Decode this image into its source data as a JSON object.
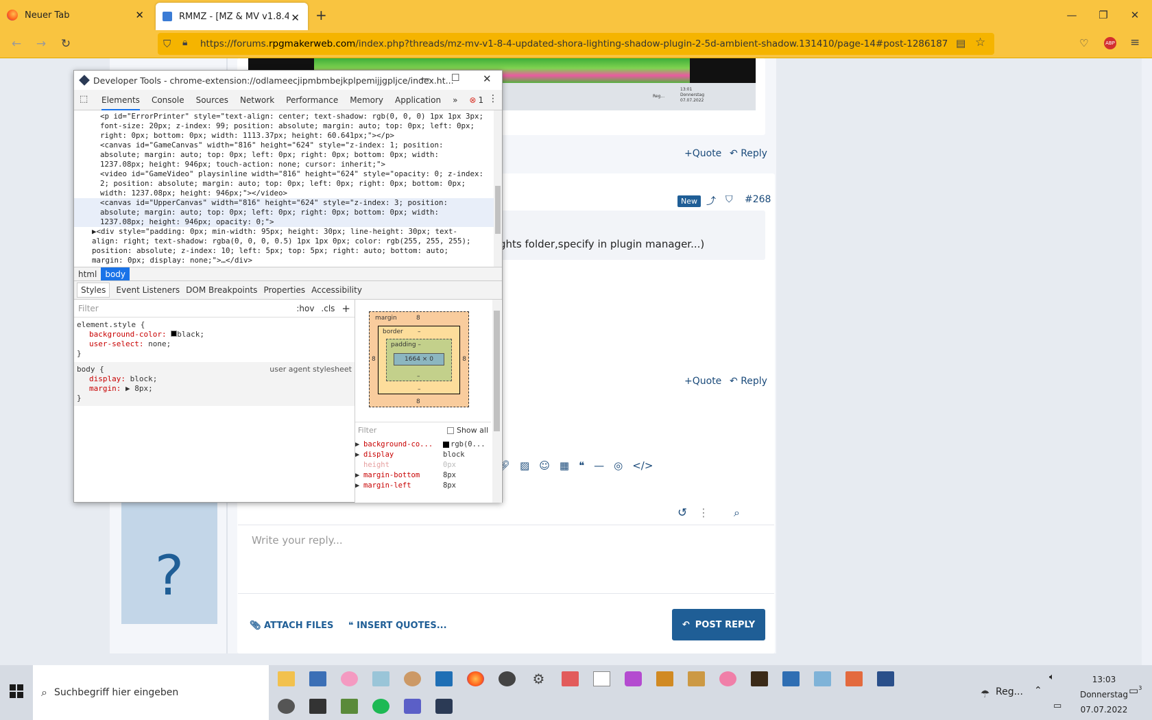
{
  "browser": {
    "tabs": [
      {
        "title": "Neuer Tab",
        "icon": "firefox-icon"
      },
      {
        "title": "RMMZ - [MZ & MV v1.8.4 UPDA",
        "icon": "rpgmaker-favicon"
      }
    ],
    "url_prefix": "https://forums.",
    "url_domain": "rpgmakerweb.com",
    "url_rest": "/index.php?threads/mz-mv-v1-8-4-updated-shora-lighting-shadow-plugin-2-5d-ambient-shadow.131410/page-14#post-1286187",
    "abp_label": "ABP"
  },
  "forum": {
    "quote_label": "+Quote",
    "reply_label": "Reply",
    "new_badge": "New",
    "post_number": "#268",
    "post_text": "ghts folder,specify in plugin manager...)",
    "avatar_letter": "?",
    "reply_placeholder": "Write your reply...",
    "attach_label": "ATTACH FILES",
    "insert_quotes_label": "INSERT QUOTES...",
    "post_reply_label": "POST REPLY",
    "embedded_clock": {
      "time": "13:01",
      "day": "Donnerstag",
      "date": "07.07.2022",
      "tray": "Reg..."
    }
  },
  "devtools": {
    "title": "Developer Tools - chrome-extension://odlameecjipmbmbejkplpemijjgpljce/index.ht...",
    "tabs": [
      "Elements",
      "Console",
      "Sources",
      "Network",
      "Performance",
      "Memory",
      "Application"
    ],
    "more": "»",
    "error_count": "1",
    "code_lines": [
      "<p id=\"ErrorPrinter\" style=\"text-align: center; text-shadow: rgb(0, 0, 0) 1px 1px 3px;",
      "font-size: 20px; z-index: 99; position: absolute; margin: auto; top: 0px; left: 0px;",
      "right: 0px; bottom: 0px; width: 1113.37px; height: 60.641px;\"></p>",
      "<canvas id=\"GameCanvas\" width=\"816\" height=\"624\" style=\"z-index: 1; position:",
      "absolute; margin: auto; top: 0px; left: 0px; right: 0px; bottom: 0px; width:",
      "1237.08px; height: 946px; touch-action: none; cursor: inherit;\">",
      "<video id=\"GameVideo\" playsinline width=\"816\" height=\"624\" style=\"opacity: 0; z-index:",
      "2; position: absolute; margin: auto; top: 0px; left: 0px; right: 0px; bottom: 0px;",
      "width: 1237.08px; height: 946px;\"></video>",
      "<canvas id=\"UpperCanvas\" width=\"816\" height=\"624\" style=\"z-index: 3; position:",
      "absolute; margin: auto; top: 0px; left: 0px; right: 0px; bottom: 0px; width:",
      "1237.08px; height: 946px; opacity: 0;\">",
      "▶<div style=\"padding: 0px; min-width: 95px; height: 30px; line-height: 30px; text-",
      "align: right; text-shadow: rgba(0, 0, 0, 0.5) 1px 1px 0px; color: rgb(255, 255, 255);",
      "position: absolute; z-index: 10; left: 5px; top: 5px; right: auto; bottom: auto;",
      "margin: 0px; display: none;\">…</div>"
    ],
    "breadcrumbs": [
      "html",
      "body"
    ],
    "subtabs": [
      "Styles",
      "Event Listeners",
      "DOM Breakpoints",
      "Properties",
      "Accessibility"
    ],
    "filter_placeholder": "Filter",
    "hov": ":hov",
    "cls": ".cls",
    "rules": [
      {
        "selector": "element.style {",
        "props": [
          [
            "background-color:",
            "black;"
          ],
          [
            "user-select:",
            "none;"
          ]
        ],
        "close": "}"
      },
      {
        "selector": "body {",
        "source": "user agent stylesheet",
        "props": [
          [
            "display:",
            "block;"
          ],
          [
            "margin:",
            "▶ 8px;"
          ]
        ],
        "close": "}"
      }
    ],
    "box": {
      "margin": "margin",
      "margin_val": "8",
      "border": "border",
      "dash": "–",
      "padding": "padding –",
      "content": "1664 × 0",
      "side": "8"
    },
    "computed_filter": "Filter",
    "show_all": "Show all",
    "computed": [
      [
        "background-co...",
        "rgb(0..."
      ],
      [
        "display",
        "block"
      ],
      [
        "height",
        "0px"
      ],
      [
        "margin-bottom",
        "8px"
      ],
      [
        "margin-left",
        "8px"
      ]
    ]
  },
  "taskbar": {
    "search_placeholder": "Suchbegriff hier eingeben",
    "time": "13:03",
    "day": "Donnerstag",
    "date": "07.07.2022",
    "weather": "Reg...",
    "notif": "3"
  }
}
